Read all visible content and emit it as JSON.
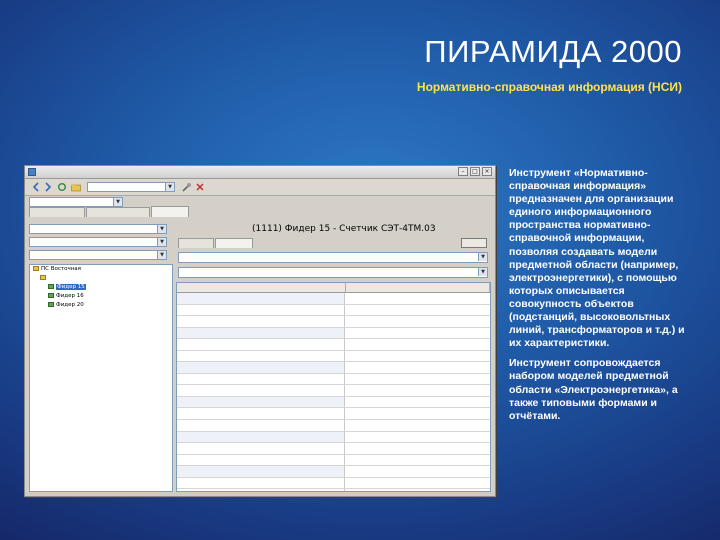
{
  "slide": {
    "title": "ПИРАМИДА 2000",
    "subtitle": "Нормативно-справочная информация (НСИ)",
    "description": [
      "Инструмент «Нормативно-справочная информация» предназначен для организации единого информационного пространства нормативно-справочной информации, позволяя создавать модели предметной области (например, электроэнергетики), с помощью которых описывается совокупность объектов (подстанций, высоковольтных линий, трансформаторов и т.д.) и их характеристики.",
      "Инструмент сопровождается набором моделей предметной области «Электроэнергетика», а также типовыми формами и отчётами."
    ]
  },
  "app": {
    "feeder_title": "(1111) Фидер 15 - Счетчик СЭТ-4ТМ.03",
    "tree": {
      "items": [
        {
          "label": "ПС Восточная"
        },
        {
          "label": "Фидер 15"
        },
        {
          "label": "Фидер 16"
        },
        {
          "label": "Фидер 20"
        }
      ]
    }
  },
  "colors": {
    "title": "#ffffff",
    "subtitle": "#ffe24a",
    "background_center": "#2e79c4",
    "background_edge": "#141f5e",
    "selection": "#316ac5"
  },
  "icons": [
    "app-icon",
    "back-arrow-icon",
    "forward-arrow-icon",
    "refresh-icon",
    "folder-icon",
    "tools-icon",
    "close-icon",
    "dropdown-arrow-icon"
  ]
}
